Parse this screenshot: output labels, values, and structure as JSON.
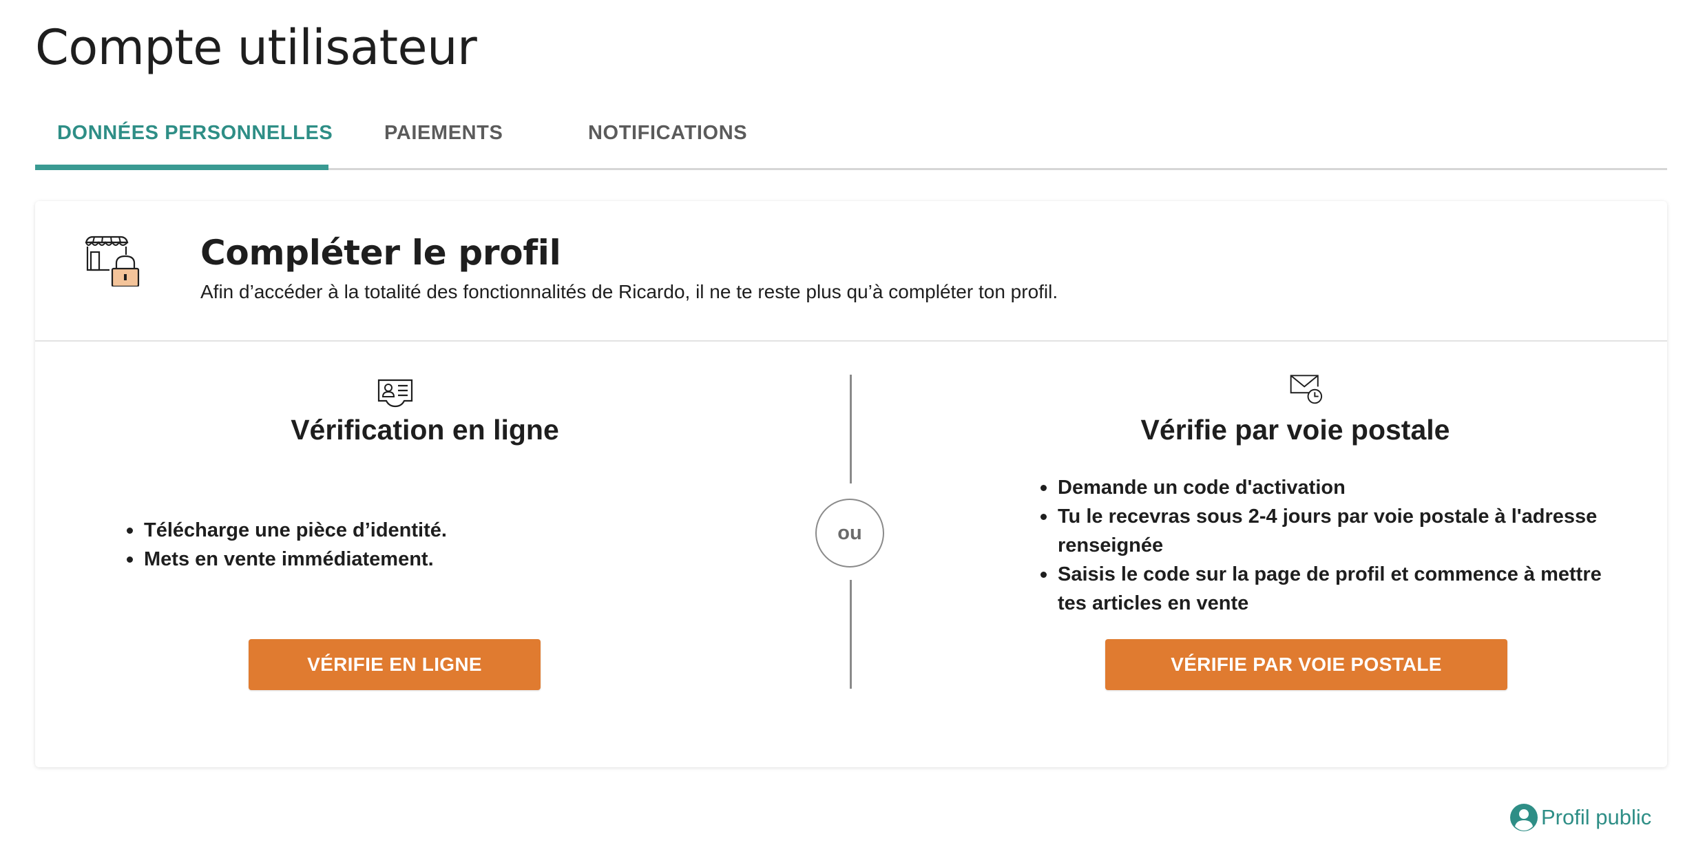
{
  "page": {
    "title": "Compte utilisateur"
  },
  "tabs": [
    {
      "label": "DONNÉES PERSONNELLES",
      "active": true
    },
    {
      "label": "PAIEMENTS",
      "active": false
    },
    {
      "label": "NOTIFICATIONS",
      "active": false
    }
  ],
  "card": {
    "icon": "shop-lock-icon",
    "title": "Compléter le profil",
    "subtitle": "Afin d’accéder à la totalité des fonctionnalités de Ricardo, il ne te reste plus qu’à compléter ton profil."
  },
  "online": {
    "icon": "id-card-icon",
    "title": "Vérification en ligne",
    "bullets": [
      "Télécharge une pièce d’identité.",
      "Mets en vente immédiatement."
    ],
    "button_label": "VÉRIFIE EN LIGNE"
  },
  "separator": {
    "label": "ou"
  },
  "postal": {
    "icon": "mail-clock-icon",
    "title": "Vérifie par voie postale",
    "bullets": [
      "Demande un code d'activation",
      "Tu le recevras sous 2-4 jours par voie postale à l'adresse renseignée",
      "Saisis le code sur la page de profil et commence à mettre tes articles en vente"
    ],
    "button_label": "VÉRIFIE PAR VOIE POSTALE"
  },
  "footer": {
    "public_profile_icon": "user-circle-icon",
    "public_profile_label": "Profil public"
  },
  "colors": {
    "accent": "#2e8e86",
    "button": "#e07b30",
    "text": "#1e1e1e"
  }
}
